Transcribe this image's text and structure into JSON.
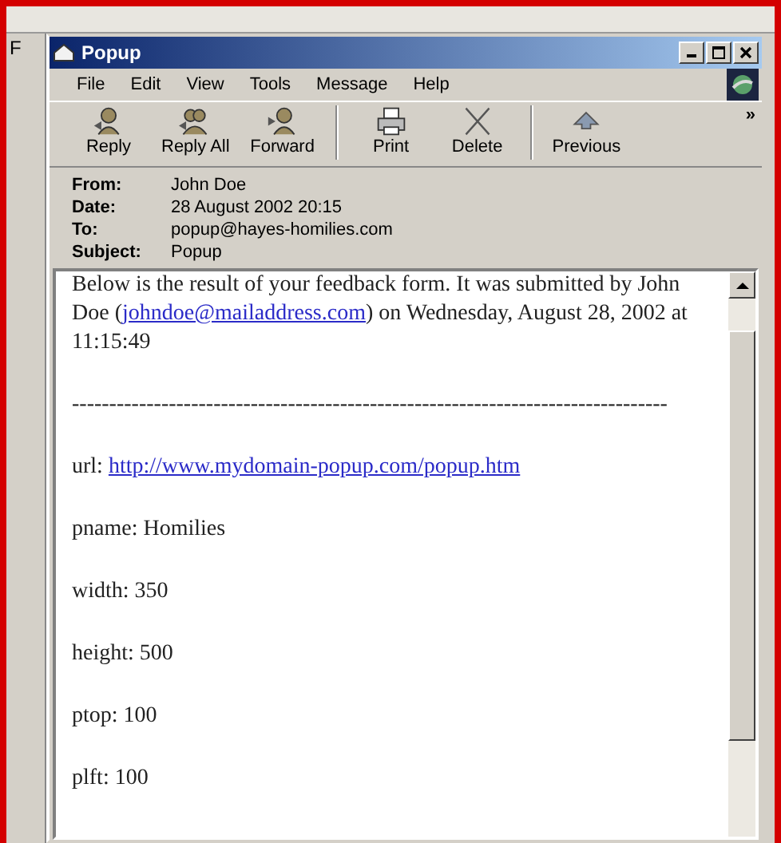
{
  "background_window": {
    "menu_letter": "F"
  },
  "window": {
    "title": "Popup"
  },
  "menu": [
    {
      "label": "File"
    },
    {
      "label": "Edit"
    },
    {
      "label": "View"
    },
    {
      "label": "Tools"
    },
    {
      "label": "Message"
    },
    {
      "label": "Help"
    }
  ],
  "toolbar": [
    {
      "label": "Reply",
      "kind": "reply"
    },
    {
      "label": "Reply All",
      "kind": "reply-all"
    },
    {
      "label": "Forward",
      "kind": "forward"
    },
    {
      "label": "Print",
      "kind": "print"
    },
    {
      "label": "Delete",
      "kind": "delete"
    },
    {
      "label": "Previous",
      "kind": "previous"
    }
  ],
  "toolbar_more": "»",
  "header": [
    {
      "label": "From:",
      "value": "John Doe"
    },
    {
      "label": "Date:",
      "value": "28 August 2002 20:15"
    },
    {
      "label": "To:",
      "value": "popup@hayes-homilies.com"
    },
    {
      "label": "Subject:",
      "value": "Popup"
    }
  ],
  "body": [
    {
      "kind": "text",
      "parts": [
        {
          "text": "Below is the result of your feedback form.  It was submitted by John Doe ("
        },
        {
          "link": "johndoe@mailaddress.com"
        },
        {
          "text": ") on Wednesday, August 28, 2002 at 11:15:49"
        }
      ]
    },
    {
      "kind": "rule",
      "parts": [
        {
          "text": "--------------------------------------------------------------------------------"
        }
      ]
    },
    {
      "kind": "text",
      "parts": [
        {
          "text": "url: "
        },
        {
          "link": "http://www.mydomain-popup.com/popup.htm"
        }
      ]
    },
    {
      "kind": "text",
      "parts": [
        {
          "text": "pname: Homilies"
        }
      ]
    },
    {
      "kind": "text",
      "parts": [
        {
          "text": "width: 350"
        }
      ]
    },
    {
      "kind": "text",
      "parts": [
        {
          "text": "height: 500"
        }
      ]
    },
    {
      "kind": "text",
      "parts": [
        {
          "text": "ptop: 100"
        }
      ]
    },
    {
      "kind": "text",
      "parts": [
        {
          "text": "plft: 100"
        }
      ]
    }
  ]
}
